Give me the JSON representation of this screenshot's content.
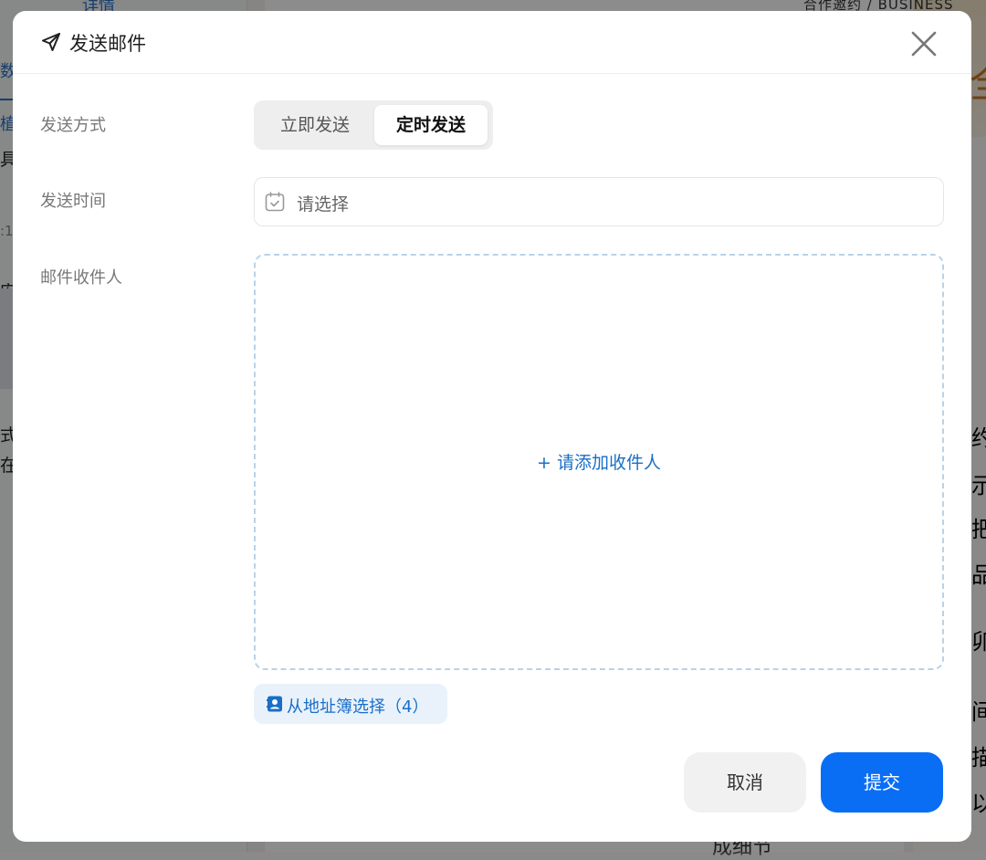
{
  "background": {
    "left_link": "详情",
    "left_tab": "数植",
    "left_texts": [
      "具",
      ":1",
      "安排",
      "式)",
      "在"
    ],
    "top_right_label": "合作邀约 / BUSINESS",
    "right_glyphs": [
      "全",
      "约",
      "示",
      "把",
      "品",
      "卯",
      "间",
      "描",
      "以"
    ],
    "bottom_text": "成细节"
  },
  "dialog": {
    "title": "发送邮件",
    "title_icon": "send-icon",
    "close_icon": "close-icon",
    "send_mode": {
      "label": "发送方式",
      "options": [
        "立即发送",
        "定时发送"
      ],
      "selected": "定时发送"
    },
    "send_time": {
      "label": "发送时间",
      "placeholder": "请选择",
      "icon": "calendar-icon"
    },
    "recipients": {
      "label": "邮件收件人",
      "add_text": "+ 请添加收件人",
      "address_book_label": "从地址簿选择（4）",
      "address_book_icon": "contact-book-icon"
    },
    "cancel_label": "取消",
    "submit_label": "提交"
  },
  "colors": {
    "primary": "#0a6ef5",
    "link": "#1a6ec7",
    "dashed_border": "#b9d2e8",
    "overlay": "rgba(0,0,0,0.45)"
  }
}
